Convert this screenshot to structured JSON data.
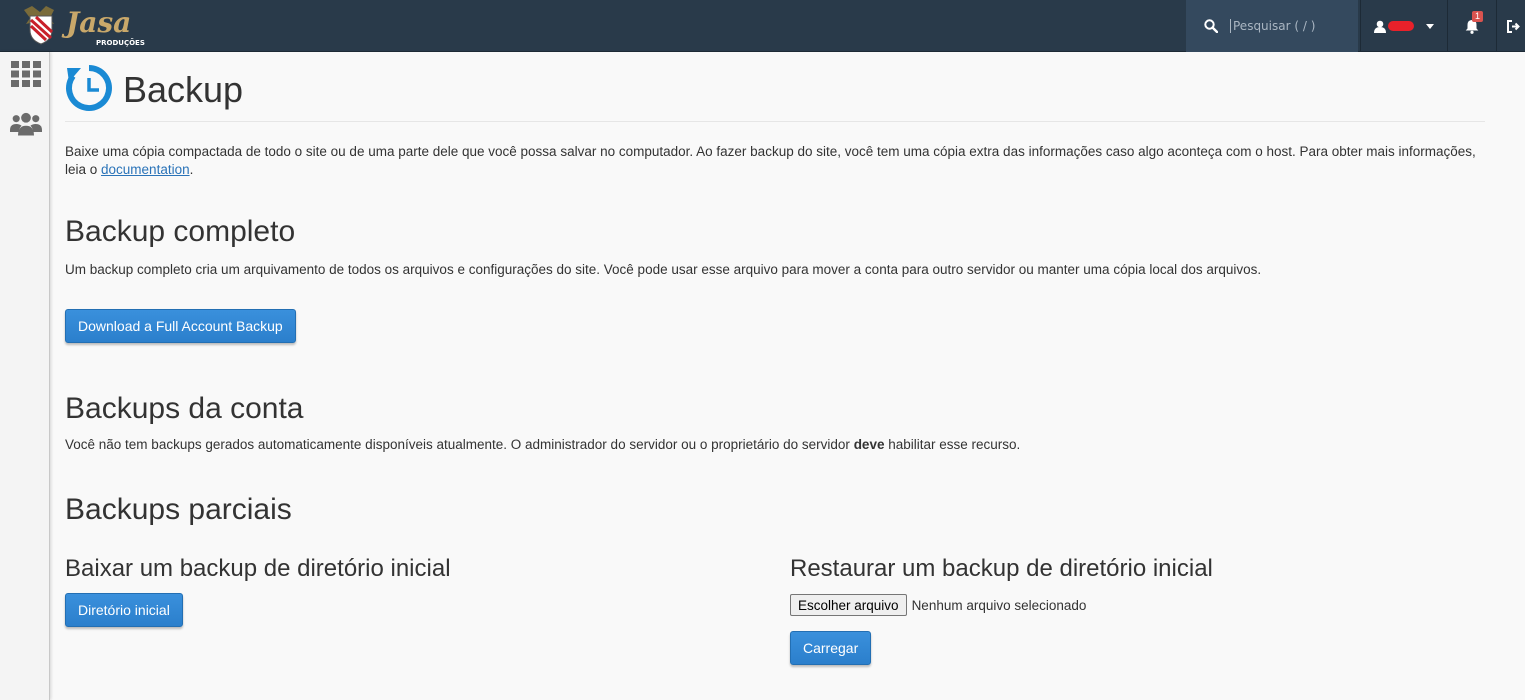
{
  "header": {
    "logo_alt": "Jasa Produções",
    "logo_text": "Jasa",
    "logo_subtext": "PRODUÇÕES",
    "search_placeholder": "Pesquisar ( / )",
    "notification_count": "1",
    "colors": {
      "bar": "#293a4a",
      "search_bg": "#34495e",
      "badge": "#d9534f"
    }
  },
  "sidebar": {
    "items": [
      {
        "icon": "grid-icon"
      },
      {
        "icon": "users-icon"
      }
    ]
  },
  "page": {
    "title": "Backup",
    "intro_text": "Baixe uma cópia compactada de todo o site ou de uma parte dele que você possa salvar no computador. Ao fazer backup do site, você tem uma cópia extra das informações caso algo aconteça com o host. Para obter mais informações, leia o ",
    "intro_link": "documentation",
    "intro_end": "."
  },
  "full_backup": {
    "heading": "Backup completo",
    "description": "Um backup completo cria um arquivamento de todos os arquivos e configurações do site. Você pode usar esse arquivo para mover a conta para outro servidor ou manter uma cópia local dos arquivos.",
    "button": "Download a Full Account Backup"
  },
  "account_backups": {
    "heading": "Backups da conta",
    "text_before": "Você não tem backups gerados automaticamente disponíveis atualmente. O administrador do servidor ou o proprietário do servidor ",
    "text_bold": "deve",
    "text_after": " habilitar esse recurso."
  },
  "partial_backups": {
    "heading": "Backups parciais",
    "download": {
      "heading": "Baixar um backup de diretório inicial",
      "button": "Diretório inicial"
    },
    "restore": {
      "heading": "Restaurar um backup de diretório inicial",
      "file_button": "Escolher arquivo",
      "file_status": "Nenhum arquivo selecionado",
      "upload_button": "Carregar"
    }
  },
  "colors": {
    "accent": "#2b84d5",
    "link": "#2a73b8",
    "icon_blue": "#1a8ad4"
  }
}
